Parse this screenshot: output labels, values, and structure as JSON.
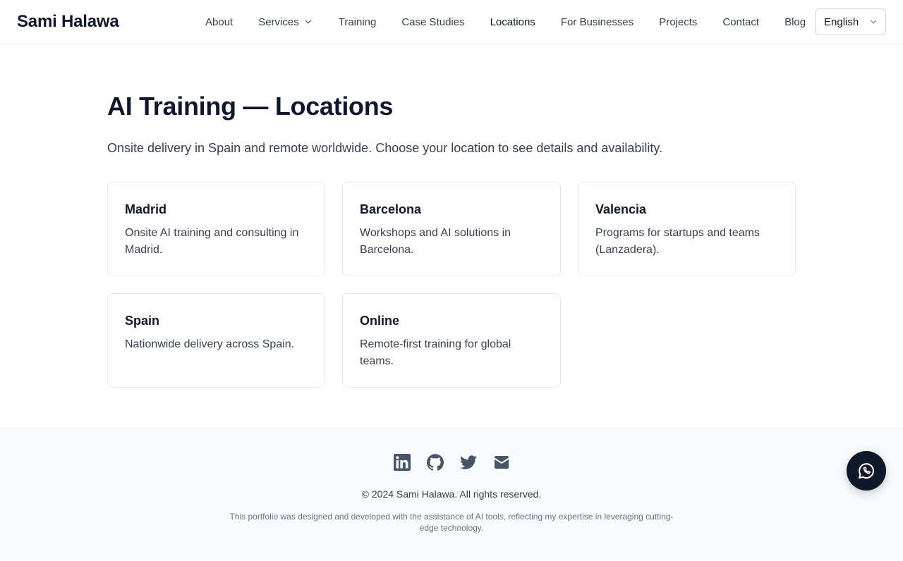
{
  "header": {
    "brand": "Sami Halawa",
    "nav": [
      {
        "label": "About"
      },
      {
        "label": "Services",
        "has_dropdown": true
      },
      {
        "label": "Training"
      },
      {
        "label": "Case Studies"
      },
      {
        "label": "Locations",
        "active": true
      },
      {
        "label": "For Businesses"
      },
      {
        "label": "Projects"
      },
      {
        "label": "Contact"
      },
      {
        "label": "Blog"
      }
    ],
    "language": {
      "selected": "English",
      "icon": "chevron-down-icon"
    }
  },
  "main": {
    "title": "AI Training — Locations",
    "subtitle": "Onsite delivery in Spain and remote worldwide. Choose your location to see details and availability.",
    "cards": [
      {
        "title": "Madrid",
        "description": "Onsite AI training and consulting in Madrid."
      },
      {
        "title": "Barcelona",
        "description": "Workshops and AI solutions in Barcelona."
      },
      {
        "title": "Valencia",
        "description": "Programs for startups and teams (Lanzadera)."
      },
      {
        "title": "Spain",
        "description": "Nationwide delivery across Spain."
      },
      {
        "title": "Online",
        "description": "Remote-first training for global teams."
      }
    ]
  },
  "footer": {
    "socials": [
      "linkedin-icon",
      "github-icon",
      "twitter-icon",
      "email-icon"
    ],
    "copyright": "© 2024 Sami Halawa. All rights reserved.",
    "disclaimer": "This portfolio was designed and developed with the assistance of AI tools, reflecting my expertise in leveraging cutting-edge technology."
  },
  "floating": {
    "icon": "whatsapp-icon"
  },
  "colors": {
    "text_primary": "#0f172a",
    "text_secondary": "#374151",
    "border": "#e5e7eb",
    "footer_bg": "#f8fafc",
    "icon": "#475569"
  }
}
